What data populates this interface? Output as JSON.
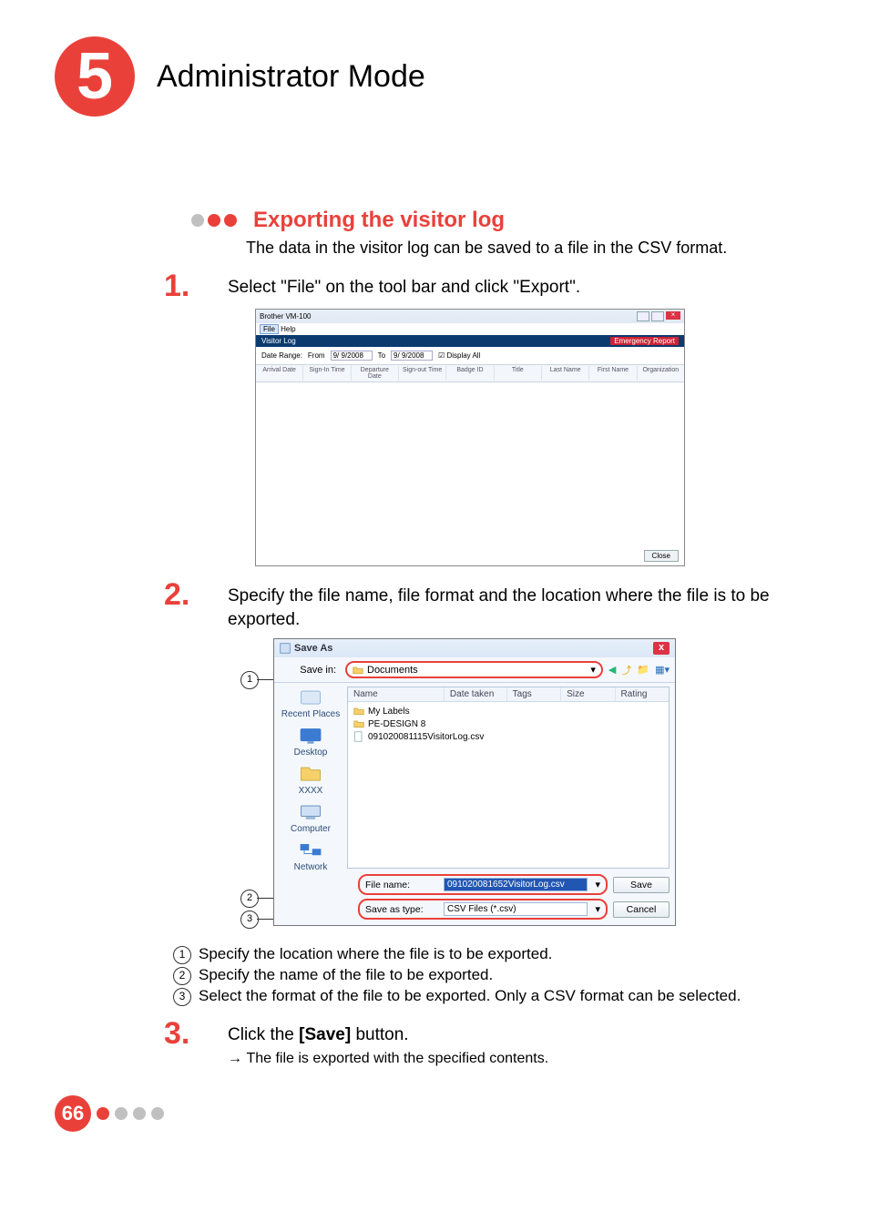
{
  "chapter": {
    "number": "5",
    "title": "Administrator Mode"
  },
  "section": {
    "title": "Exporting the visitor log",
    "desc": "The data in the visitor log can be saved to a file in the CSV format."
  },
  "steps": {
    "s1": {
      "num": "1.",
      "text": "Select \"File\" on the tool bar and click \"Export\"."
    },
    "s2": {
      "num": "2.",
      "text": "Specify the file name, file format and the location where the file is to be exported."
    },
    "s3": {
      "num": "3.",
      "text_prefix": "Click the ",
      "bold": "[Save]",
      "text_suffix": " button.",
      "result": "The file is exported with the specified contents."
    }
  },
  "legend": {
    "l1": "Specify the location where the file is to be exported.",
    "l2": "Specify the name of the file to be exported.",
    "l3": "Select the format of the file to be exported. Only a CSV format can be selected."
  },
  "screenshot1": {
    "window_title": "Brother VM-100",
    "menu_file": "File",
    "menu_help": "Help",
    "subtitle": "Visitor Log",
    "emergency": "Emergency Report",
    "filter": {
      "date_range": "Date Range:",
      "from": "From",
      "from_val": "9/ 9/2008",
      "to": "To",
      "to_val": "9/ 9/2008",
      "display_all": "Display All"
    },
    "cols": [
      "Arrival Date",
      "Sign-In Time",
      "Departure Date",
      "Sign-out Time",
      "Badge ID",
      "Title",
      "Last Name",
      "First Name",
      "Organization"
    ],
    "close": "Close"
  },
  "screenshot2": {
    "title": "Save As",
    "save_in_label": "Save in:",
    "save_in_value": "Documents",
    "toolbar_icons": [
      "back",
      "up",
      "new-folder",
      "views"
    ],
    "columns": {
      "name": "Name",
      "date": "Date taken",
      "tags": "Tags",
      "size": "Size",
      "rating": "Rating"
    },
    "places": [
      "Recent Places",
      "Desktop",
      "XXXX",
      "Computer",
      "Network"
    ],
    "files": [
      "My Labels",
      "PE-DESIGN 8",
      "091020081115VisitorLog.csv"
    ],
    "file_name_label": "File name:",
    "file_name_value": "091020081652VisitorLog.csv",
    "save_type_label": "Save as type:",
    "save_type_value": "CSV Files (*.csv)",
    "save_btn": "Save",
    "cancel_btn": "Cancel"
  },
  "page_number": "66"
}
